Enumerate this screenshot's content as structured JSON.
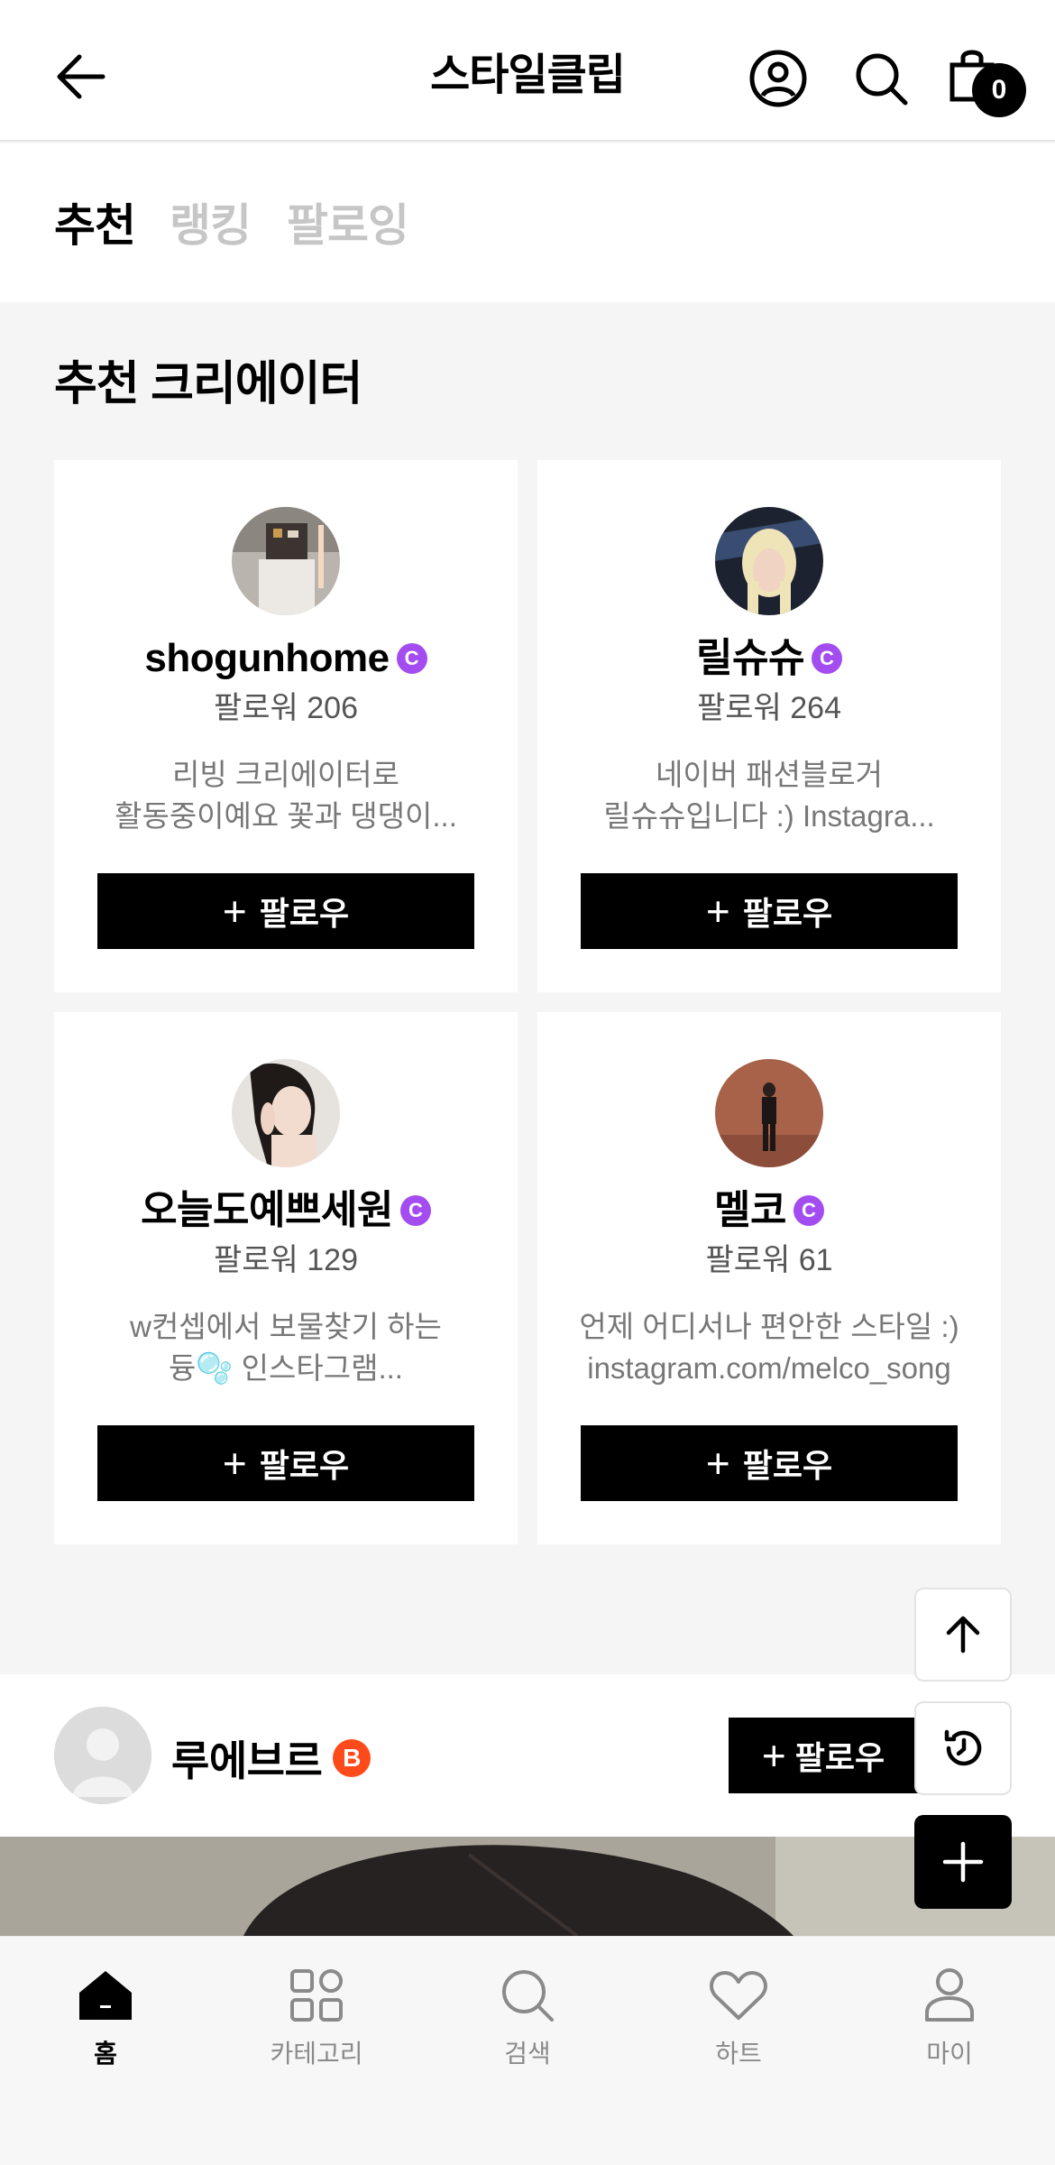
{
  "header": {
    "title": "스타일클립",
    "cart_count": "0"
  },
  "tabs": [
    {
      "label": "추천",
      "active": true
    },
    {
      "label": "랭킹",
      "active": false
    },
    {
      "label": "팔로잉",
      "active": false
    }
  ],
  "section": {
    "title": "추천 크리에이터"
  },
  "creators": [
    {
      "name": "shogunhome",
      "badge": "C",
      "followers": "팔로워 206",
      "bio": "리빙 크리에이터로\n활동중이예요 꽃과 댕댕이...",
      "follow_label": "팔로우"
    },
    {
      "name": "릴슈슈",
      "badge": "C",
      "followers": "팔로워 264",
      "bio": "네이버 패션블로거\n릴슈슈입니다 :) Instagra...",
      "follow_label": "팔로우"
    },
    {
      "name": "오늘도예쁘세원",
      "badge": "C",
      "followers": "팔로워 129",
      "bio": "w컨셉에서 보물찾기 하는\n듕🫧 인스타그램...",
      "follow_label": "팔로우"
    },
    {
      "name": "멜코",
      "badge": "C",
      "followers": "팔로워 61",
      "bio": "언제 어디서나 편안한 스타일 :)\ninstagram.com/melco_song",
      "follow_label": "팔로우"
    }
  ],
  "post": {
    "author": "루에브르",
    "badge": "B",
    "follow_label": "팔로우"
  },
  "bottom_nav": [
    {
      "label": "홈",
      "icon": "home-icon",
      "active": true
    },
    {
      "label": "카테고리",
      "icon": "category-icon",
      "active": false
    },
    {
      "label": "검색",
      "icon": "search-icon",
      "active": false
    },
    {
      "label": "하트",
      "icon": "heart-icon",
      "active": false
    },
    {
      "label": "마이",
      "icon": "user-icon",
      "active": false
    }
  ],
  "colors": {
    "creator_badge": "#a34cf0",
    "brand_badge": "#ff4a1c",
    "inactive_tab": "#c6c6c6",
    "background": "#f5f5f5"
  }
}
